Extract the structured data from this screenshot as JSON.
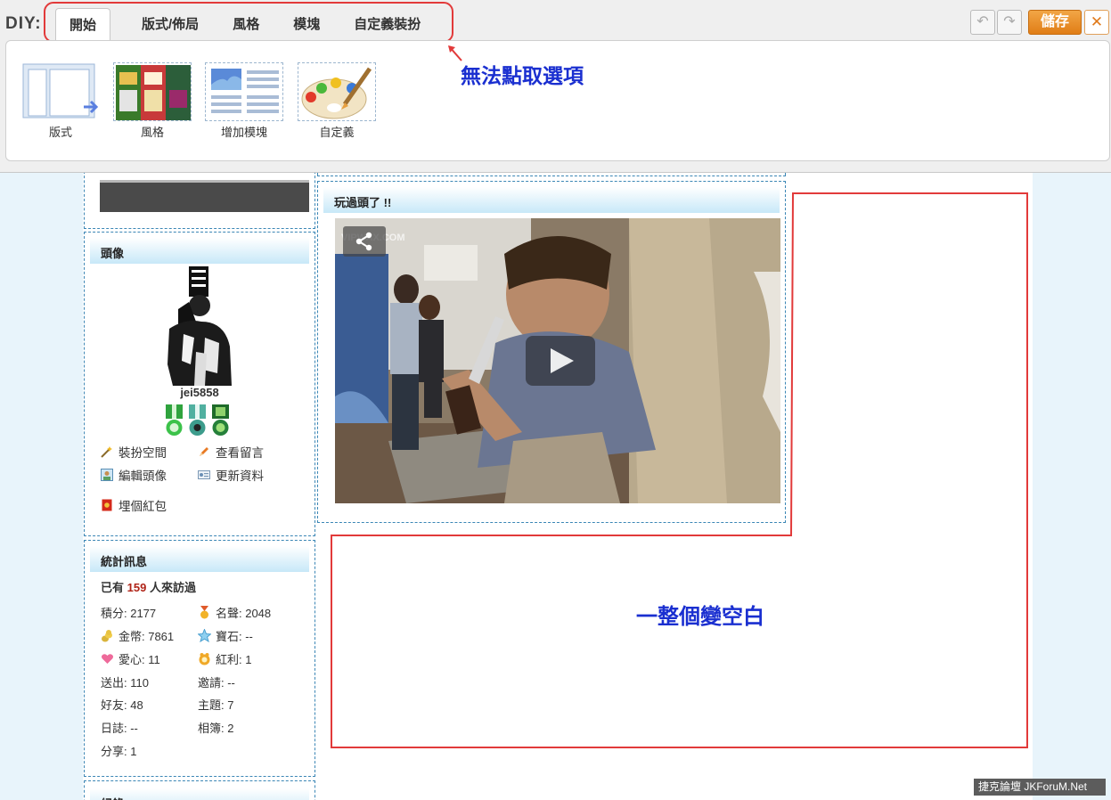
{
  "diy": {
    "label": "DIY:",
    "tabs": [
      {
        "label": "開始",
        "active": true
      },
      {
        "label": "版式/佈局"
      },
      {
        "label": "風格"
      },
      {
        "label": "模塊"
      },
      {
        "label": "自定義裝扮"
      }
    ],
    "tools": [
      {
        "label": "版式",
        "icon": "layout-icon"
      },
      {
        "label": "風格",
        "icon": "style-thumbnail-icon"
      },
      {
        "label": "增加模塊",
        "icon": "add-module-icon"
      },
      {
        "label": "自定義",
        "icon": "palette-icon"
      }
    ],
    "save_label": "儲存",
    "close_label": "✕",
    "undo_label": "↶",
    "redo_label": "↷"
  },
  "annotations": {
    "tabs_note": "無法點取選項",
    "blank_note": "一整個變空白"
  },
  "profile": {
    "avatar_title": "頭像",
    "username": "jei5858",
    "medals": [
      "medal-1-icon",
      "medal-2-icon",
      "medal-3-icon"
    ],
    "links": [
      {
        "label": "裝扮空間",
        "icon": "wand-icon"
      },
      {
        "label": "查看留言",
        "icon": "pencil-icon"
      },
      {
        "label": "編輯頭像",
        "icon": "avatar-edit-icon"
      },
      {
        "label": "更新資料",
        "icon": "id-card-icon"
      },
      {
        "label": "埋個紅包",
        "icon": "red-envelope-icon"
      }
    ]
  },
  "stats": {
    "title": "統計訊息",
    "visits_prefix": "已有",
    "visits_count": "159",
    "visits_suffix": "人來訪過",
    "items": [
      {
        "label": "積分: 2177"
      },
      {
        "label": "名聲: 2048",
        "icon": "medal-icon"
      },
      {
        "label": "金幣: 7861",
        "icon": "coins-icon"
      },
      {
        "label": "寶石: --",
        "icon": "gem-icon"
      },
      {
        "label": "愛心: 11",
        "icon": "heart-icon"
      },
      {
        "label": "紅利: 1",
        "icon": "bonus-icon"
      },
      {
        "label": "送出: 110"
      },
      {
        "label": "邀請: --"
      },
      {
        "label": "好友: 48"
      },
      {
        "label": "主題: 7"
      },
      {
        "label": "日誌: --"
      },
      {
        "label": "相簿: 2"
      },
      {
        "label": "分享: 1"
      }
    ],
    "next_block_title": "紀錄"
  },
  "video_block": {
    "title": "玩過頭了 !!",
    "watermark": "VIPWAX.COM"
  },
  "footer": {
    "stamp": "捷克論壇 JKForuM.Net"
  },
  "colors": {
    "annotation_blue": "#1a2fd0",
    "highlight_red": "#e23a3a",
    "save_orange": "#e07d16",
    "title_gradient_end": "#c7e8f8",
    "visit_count_red": "#b02418"
  }
}
